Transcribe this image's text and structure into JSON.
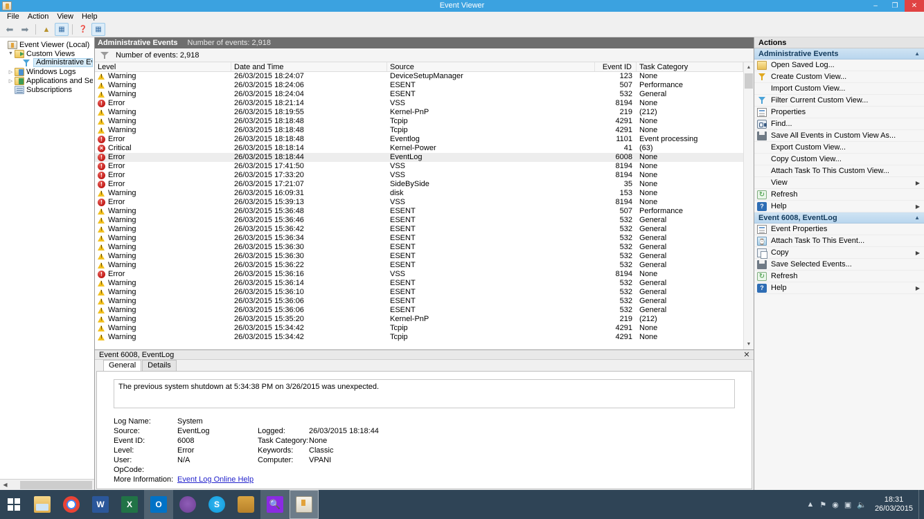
{
  "window": {
    "title": "Event Viewer",
    "app_icon": "event-viewer-icon",
    "minimize": "–",
    "restore": "❐",
    "close": "✕"
  },
  "menubar": {
    "items": [
      "File",
      "Action",
      "View",
      "Help"
    ]
  },
  "toolbar": {
    "buttons": [
      {
        "name": "back-button",
        "glyph": "←"
      },
      {
        "name": "forward-button",
        "glyph": "→"
      },
      {
        "name": "up-one-level-button",
        "glyph": "↗"
      },
      {
        "name": "show-hide-console-tree-button",
        "glyph": "▤"
      },
      {
        "name": "help-button",
        "glyph": "?"
      },
      {
        "name": "show-hide-action-pane-button",
        "glyph": "▥"
      }
    ]
  },
  "tree": {
    "items": [
      {
        "label": "Event Viewer (Local)",
        "icon": "event-viewer-icon",
        "indent": 0,
        "expander": "",
        "selected": false
      },
      {
        "label": "Custom Views",
        "icon": "folder-icon",
        "indent": 1,
        "expander": "▼",
        "selected": false
      },
      {
        "label": "Administrative Events",
        "icon": "filter-icon",
        "indent": 2,
        "expander": "",
        "selected": true
      },
      {
        "label": "Windows Logs",
        "icon": "folder-icon",
        "indent": 1,
        "expander": "▷",
        "selected": false
      },
      {
        "label": "Applications and Services Lo",
        "icon": "folder-icon",
        "indent": 1,
        "expander": "▷",
        "selected": false
      },
      {
        "label": "Subscriptions",
        "icon": "subscriptions-icon",
        "indent": 1,
        "expander": "",
        "selected": false
      }
    ]
  },
  "center": {
    "header_title": "Administrative Events",
    "header_count": "Number of events: 2,918",
    "filter_text": "Number of events: 2,918",
    "columns": [
      "Level",
      "Date and Time",
      "Source",
      "Event ID",
      "Task Category"
    ],
    "rows": [
      {
        "level": "Warning",
        "icon": "warning-icon",
        "date": "26/03/2015 18:24:07",
        "source": "DeviceSetupManager",
        "event_id": "123",
        "task": "None",
        "selected": false
      },
      {
        "level": "Warning",
        "icon": "warning-icon",
        "date": "26/03/2015 18:24:06",
        "source": "ESENT",
        "event_id": "507",
        "task": "Performance",
        "selected": false
      },
      {
        "level": "Warning",
        "icon": "warning-icon",
        "date": "26/03/2015 18:24:04",
        "source": "ESENT",
        "event_id": "532",
        "task": "General",
        "selected": false
      },
      {
        "level": "Error",
        "icon": "error-icon",
        "date": "26/03/2015 18:21:14",
        "source": "VSS",
        "event_id": "8194",
        "task": "None",
        "selected": false
      },
      {
        "level": "Warning",
        "icon": "warning-icon",
        "date": "26/03/2015 18:19:55",
        "source": "Kernel-PnP",
        "event_id": "219",
        "task": "(212)",
        "selected": false
      },
      {
        "level": "Warning",
        "icon": "warning-icon",
        "date": "26/03/2015 18:18:48",
        "source": "Tcpip",
        "event_id": "4291",
        "task": "None",
        "selected": false
      },
      {
        "level": "Warning",
        "icon": "warning-icon",
        "date": "26/03/2015 18:18:48",
        "source": "Tcpip",
        "event_id": "4291",
        "task": "None",
        "selected": false
      },
      {
        "level": "Error",
        "icon": "error-icon",
        "date": "26/03/2015 18:18:48",
        "source": "Eventlog",
        "event_id": "1101",
        "task": "Event processing",
        "selected": false
      },
      {
        "level": "Critical",
        "icon": "critical-icon",
        "date": "26/03/2015 18:18:14",
        "source": "Kernel-Power",
        "event_id": "41",
        "task": "(63)",
        "selected": false
      },
      {
        "level": "Error",
        "icon": "error-icon",
        "date": "26/03/2015 18:18:44",
        "source": "EventLog",
        "event_id": "6008",
        "task": "None",
        "selected": true
      },
      {
        "level": "Error",
        "icon": "error-icon",
        "date": "26/03/2015 17:41:50",
        "source": "VSS",
        "event_id": "8194",
        "task": "None",
        "selected": false
      },
      {
        "level": "Error",
        "icon": "error-icon",
        "date": "26/03/2015 17:33:20",
        "source": "VSS",
        "event_id": "8194",
        "task": "None",
        "selected": false
      },
      {
        "level": "Error",
        "icon": "error-icon",
        "date": "26/03/2015 17:21:07",
        "source": "SideBySide",
        "event_id": "35",
        "task": "None",
        "selected": false
      },
      {
        "level": "Warning",
        "icon": "warning-icon",
        "date": "26/03/2015 16:09:31",
        "source": "disk",
        "event_id": "153",
        "task": "None",
        "selected": false
      },
      {
        "level": "Error",
        "icon": "error-icon",
        "date": "26/03/2015 15:39:13",
        "source": "VSS",
        "event_id": "8194",
        "task": "None",
        "selected": false
      },
      {
        "level": "Warning",
        "icon": "warning-icon",
        "date": "26/03/2015 15:36:48",
        "source": "ESENT",
        "event_id": "507",
        "task": "Performance",
        "selected": false
      },
      {
        "level": "Warning",
        "icon": "warning-icon",
        "date": "26/03/2015 15:36:46",
        "source": "ESENT",
        "event_id": "532",
        "task": "General",
        "selected": false
      },
      {
        "level": "Warning",
        "icon": "warning-icon",
        "date": "26/03/2015 15:36:42",
        "source": "ESENT",
        "event_id": "532",
        "task": "General",
        "selected": false
      },
      {
        "level": "Warning",
        "icon": "warning-icon",
        "date": "26/03/2015 15:36:34",
        "source": "ESENT",
        "event_id": "532",
        "task": "General",
        "selected": false
      },
      {
        "level": "Warning",
        "icon": "warning-icon",
        "date": "26/03/2015 15:36:30",
        "source": "ESENT",
        "event_id": "532",
        "task": "General",
        "selected": false
      },
      {
        "level": "Warning",
        "icon": "warning-icon",
        "date": "26/03/2015 15:36:30",
        "source": "ESENT",
        "event_id": "532",
        "task": "General",
        "selected": false
      },
      {
        "level": "Warning",
        "icon": "warning-icon",
        "date": "26/03/2015 15:36:22",
        "source": "ESENT",
        "event_id": "532",
        "task": "General",
        "selected": false
      },
      {
        "level": "Error",
        "icon": "error-icon",
        "date": "26/03/2015 15:36:16",
        "source": "VSS",
        "event_id": "8194",
        "task": "None",
        "selected": false
      },
      {
        "level": "Warning",
        "icon": "warning-icon",
        "date": "26/03/2015 15:36:14",
        "source": "ESENT",
        "event_id": "532",
        "task": "General",
        "selected": false
      },
      {
        "level": "Warning",
        "icon": "warning-icon",
        "date": "26/03/2015 15:36:10",
        "source": "ESENT",
        "event_id": "532",
        "task": "General",
        "selected": false
      },
      {
        "level": "Warning",
        "icon": "warning-icon",
        "date": "26/03/2015 15:36:06",
        "source": "ESENT",
        "event_id": "532",
        "task": "General",
        "selected": false
      },
      {
        "level": "Warning",
        "icon": "warning-icon",
        "date": "26/03/2015 15:36:06",
        "source": "ESENT",
        "event_id": "532",
        "task": "General",
        "selected": false
      },
      {
        "level": "Warning",
        "icon": "warning-icon",
        "date": "26/03/2015 15:35:20",
        "source": "Kernel-PnP",
        "event_id": "219",
        "task": "(212)",
        "selected": false
      },
      {
        "level": "Warning",
        "icon": "warning-icon",
        "date": "26/03/2015 15:34:42",
        "source": "Tcpip",
        "event_id": "4291",
        "task": "None",
        "selected": false
      },
      {
        "level": "Warning",
        "icon": "warning-icon",
        "date": "26/03/2015 15:34:42",
        "source": "Tcpip",
        "event_id": "4291",
        "task": "None",
        "selected": false
      }
    ]
  },
  "details": {
    "header": "Event 6008, EventLog",
    "close_label": "✕",
    "tabs": [
      {
        "label": "General",
        "active": true
      },
      {
        "label": "Details",
        "active": false
      }
    ],
    "message": "The previous system shutdown at 5:34:38 PM on 3/26/2015 was unexpected.",
    "fields": [
      {
        "key": "Log Name:",
        "value": "System",
        "key2": "",
        "value2": ""
      },
      {
        "key": "Source:",
        "value": "EventLog",
        "key2": "Logged:",
        "value2": "26/03/2015 18:18:44"
      },
      {
        "key": "Event ID:",
        "value": "6008",
        "key2": "Task Category:",
        "value2": "None"
      },
      {
        "key": "Level:",
        "value": "Error",
        "key2": "Keywords:",
        "value2": "Classic"
      },
      {
        "key": "User:",
        "value": "N/A",
        "key2": "Computer:",
        "value2": "VPANI"
      },
      {
        "key": "OpCode:",
        "value": "",
        "key2": "",
        "value2": ""
      }
    ],
    "more_info_label": "More Information:",
    "more_info_link": "Event Log Online Help"
  },
  "actions": {
    "title": "Actions",
    "sections": [
      {
        "header": "Administrative Events",
        "collapse_glyph": "▲",
        "items": [
          {
            "label": "Open Saved Log...",
            "icon": "open-folder-icon",
            "submenu": ""
          },
          {
            "label": "Create Custom View...",
            "icon": "filter-yellow-icon",
            "submenu": ""
          },
          {
            "label": "Import Custom View...",
            "icon": "",
            "submenu": ""
          },
          {
            "label": "Filter Current Custom View...",
            "icon": "filter-blue-icon",
            "submenu": ""
          },
          {
            "label": "Properties",
            "icon": "properties-icon",
            "submenu": ""
          },
          {
            "label": "Find...",
            "icon": "find-icon",
            "submenu": ""
          },
          {
            "label": "Save All Events in Custom View As...",
            "icon": "save-icon",
            "submenu": ""
          },
          {
            "label": "Export Custom View...",
            "icon": "",
            "submenu": ""
          },
          {
            "label": "Copy Custom View...",
            "icon": "",
            "submenu": ""
          },
          {
            "label": "Attach Task To This Custom View...",
            "icon": "",
            "submenu": ""
          },
          {
            "label": "View",
            "icon": "",
            "submenu": "▶"
          },
          {
            "label": "Refresh",
            "icon": "refresh-icon",
            "submenu": ""
          },
          {
            "label": "Help",
            "icon": "help-icon",
            "submenu": "▶"
          }
        ]
      },
      {
        "header": "Event 6008, EventLog",
        "collapse_glyph": "▲",
        "items": [
          {
            "label": "Event Properties",
            "icon": "properties-icon",
            "submenu": ""
          },
          {
            "label": "Attach Task To This Event...",
            "icon": "attach-task-icon",
            "submenu": ""
          },
          {
            "label": "Copy",
            "icon": "copy-icon",
            "submenu": "▶"
          },
          {
            "label": "Save Selected Events...",
            "icon": "save-icon",
            "submenu": ""
          },
          {
            "label": "Refresh",
            "icon": "refresh-icon",
            "submenu": ""
          },
          {
            "label": "Help",
            "icon": "help-icon",
            "submenu": "▶"
          }
        ]
      }
    ]
  },
  "taskbar": {
    "start_label": "Start",
    "apps": [
      {
        "name": "file-explorer-icon",
        "cls": "ai-explorer",
        "text": "",
        "state": ""
      },
      {
        "name": "chrome-icon",
        "cls": "ai-chrome",
        "text": "",
        "state": ""
      },
      {
        "name": "word-icon",
        "cls": "ai-word",
        "text": "W",
        "state": ""
      },
      {
        "name": "excel-icon",
        "cls": "ai-excel",
        "text": "X",
        "state": ""
      },
      {
        "name": "outlook-icon",
        "cls": "ai-outlook",
        "text": "O",
        "state": "active"
      },
      {
        "name": "viber-icon",
        "cls": "ai-viber",
        "text": "",
        "state": ""
      },
      {
        "name": "skype-icon",
        "cls": "ai-skype",
        "text": "S",
        "state": ""
      },
      {
        "name": "honeycomb-icon",
        "cls": "ai-honey",
        "text": "",
        "state": ""
      },
      {
        "name": "search-app-icon",
        "cls": "ai-search",
        "text": "",
        "state": "active"
      },
      {
        "name": "event-viewer-taskbar-icon",
        "cls": "ai-eventvwr",
        "text": "",
        "state": "pinned-box"
      }
    ],
    "tray_icons": [
      "▲",
      "⚑",
      "◉",
      "▣",
      "◂))"
    ],
    "clock_time": "18:31",
    "clock_date": "26/03/2015"
  }
}
